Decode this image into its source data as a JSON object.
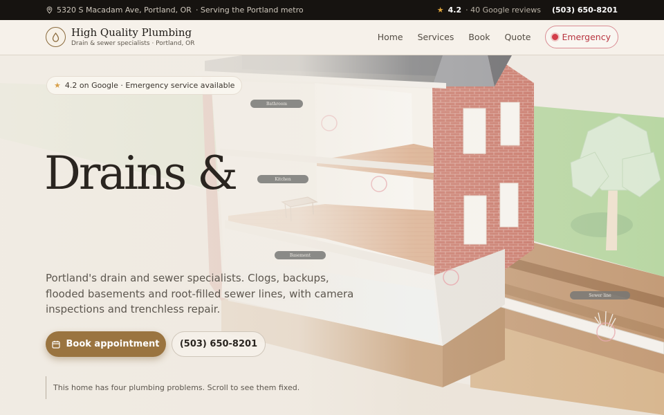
{
  "topbar": {
    "address": "5320 S Macadam Ave, Portland, OR",
    "service_area": "· Serving the Portland metro",
    "rating": "4.2",
    "reviews": "· 40 Google reviews",
    "phone": "(503) 650-8201",
    "icons": {
      "location": "map-pin-icon",
      "star": "star-icon"
    }
  },
  "header": {
    "brand_name": "High Quality Plumbing",
    "brand_sub": "Drain & sewer specialists · Portland, OR",
    "logo_icon": "water-drop-icon",
    "nav": [
      "Home",
      "Services",
      "Book",
      "Quote"
    ],
    "emergency_label": "Emergency"
  },
  "scene": {
    "labels": {
      "bathroom": "Bathroom",
      "kitchen": "Kitchen",
      "basement": "Basement",
      "sewer": "Sewer line"
    }
  },
  "hero": {
    "badge": "4.2 on Google · Emergency service available",
    "title": "Drains &",
    "description": "Portland's drain and sewer specialists. Clogs, backups, flooded basements and root-filled sewer lines, with camera inspections and trenchless repair.",
    "primary_cta": "Book appointment",
    "secondary_cta": "(503) 650-8201",
    "scroll_note": "This home has four plumbing problems. Scroll to see them fixed."
  },
  "colors": {
    "accent": "#9a7440",
    "emergency": "#d23c48",
    "topbar_bg": "#161310",
    "page_bg": "#f1ece4",
    "star": "#e0a63c"
  }
}
